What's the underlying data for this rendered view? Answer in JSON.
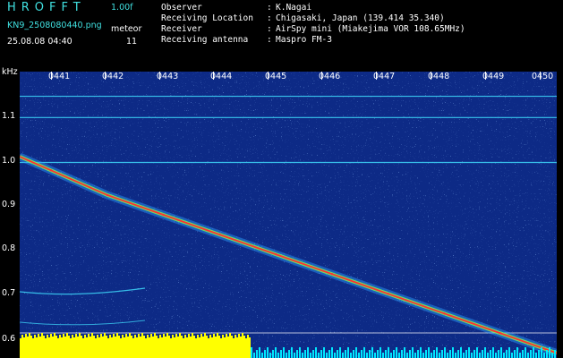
{
  "header": {
    "logo": "HROFFT",
    "version": "1.00f",
    "filename": "KN9_2508080440.png",
    "timestamp": "25.08.08 04:40",
    "meteor_label": "meteor",
    "meteor_count": "11",
    "info_labels": [
      "Observer",
      "Receiving Location",
      "Receiver",
      "Receiving antenna"
    ],
    "info_values": [
      "K.Nagai",
      "Chigasaki, Japan (139.414 35.340)",
      "AirSpy mini (Miakejima VOR 108.65MHz)",
      "Maspro FM-3"
    ],
    "sep": ":"
  },
  "axes": {
    "y_unit": "kHz",
    "y_ticks": [
      "1.1",
      "1.0",
      "0.9",
      "0.8",
      "0.7",
      "0.6"
    ],
    "x_ticks": [
      "0441",
      "0442",
      "0443",
      "0444",
      "0445",
      "0446",
      "0447",
      "0448",
      "0449",
      "0450"
    ]
  },
  "chart_data": {
    "type": "heatmap",
    "title": "",
    "ylabel": "kHz",
    "ylim": [
      0.58,
      1.16
    ],
    "x": [
      "0441",
      "0442",
      "0443",
      "0444",
      "0445",
      "0446",
      "0447",
      "0448",
      "0449",
      "0450"
    ],
    "series": [
      {
        "values": [
          0.96,
          0.91,
          0.87,
          0.83,
          0.79,
          0.75,
          0.71,
          0.67,
          0.63,
          0.59
        ]
      }
    ],
    "grid": false,
    "colors": {
      "background": "#0d2a86",
      "trace": "#ff3030",
      "carrier": "#40e0ff",
      "echo_bar": "#ffff00",
      "noise_bar": "#00e8ff"
    }
  }
}
